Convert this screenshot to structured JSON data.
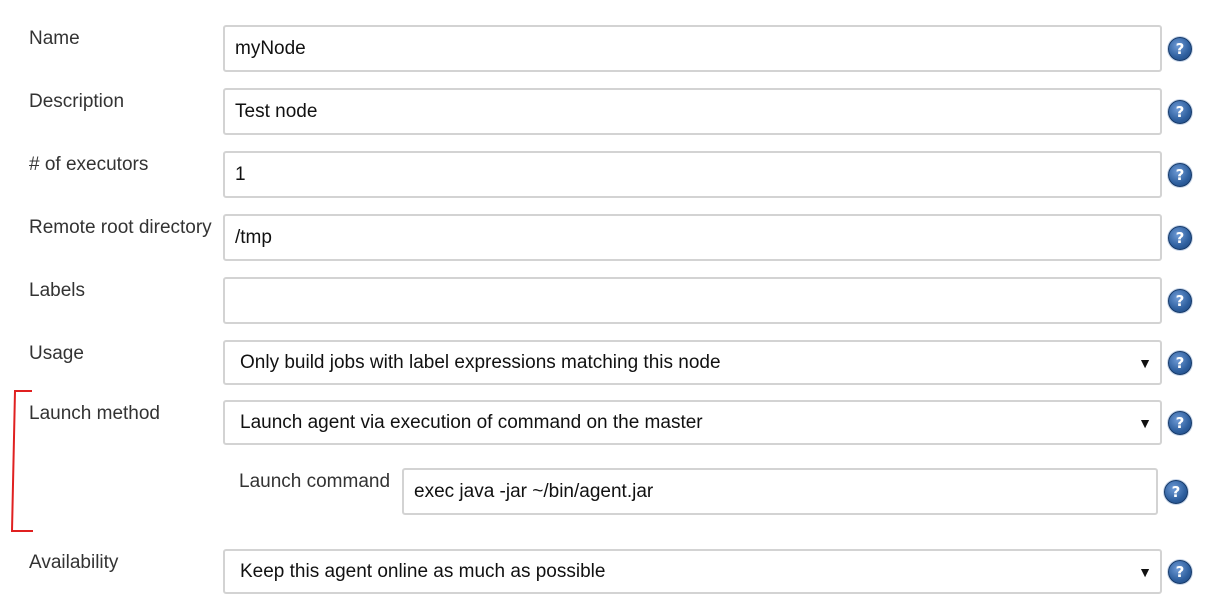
{
  "form": {
    "name": {
      "label": "Name",
      "value": "myNode"
    },
    "description": {
      "label": "Description",
      "value": "Test node"
    },
    "executors": {
      "label": "# of executors",
      "value": "1"
    },
    "remote_root": {
      "label": "Remote root directory",
      "value": "/tmp"
    },
    "labels": {
      "label": "Labels",
      "value": ""
    },
    "usage": {
      "label": "Usage",
      "selected": "Only build jobs with label expressions matching this node"
    },
    "launch_method": {
      "label": "Launch method",
      "selected": "Launch agent via execution of command on the master"
    },
    "launch_command": {
      "label": "Launch command",
      "value": "exec java -jar ~/bin/agent.jar"
    },
    "availability": {
      "label": "Availability",
      "selected": "Keep this agent online as much as possible"
    }
  },
  "icons": {
    "help": "help-icon",
    "dropdown": "dropdown-arrow-icon"
  },
  "glyphs": {
    "help": "?",
    "arrow": "▼"
  },
  "colors": {
    "annotation_bracket": "#e02020",
    "help_icon": "#2e5f9e",
    "field_border": "#d3d3d3"
  }
}
